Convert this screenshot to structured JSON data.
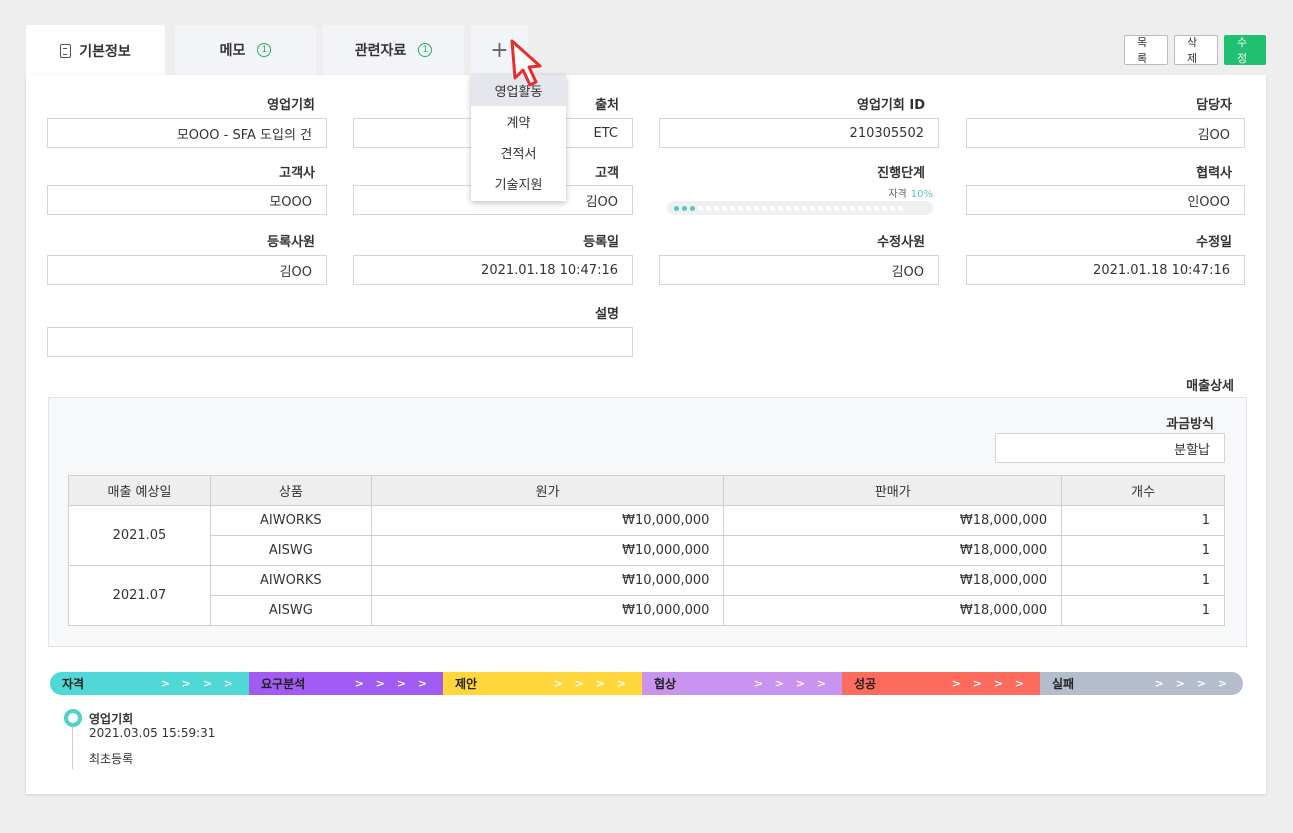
{
  "tabs": [
    {
      "label": "기본정보",
      "count": ""
    },
    {
      "label": "메모",
      "count": "1"
    },
    {
      "label": "관련자료",
      "count": "1"
    },
    {
      "label": "+",
      "count": ""
    }
  ],
  "buttons": {
    "list": "목록",
    "delete": "삭제",
    "edit": "수정"
  },
  "dropdown": [
    "영업활동",
    "계약",
    "견적서",
    "기술지원"
  ],
  "fields": {
    "opportunity": {
      "label": "영업기회",
      "value": "모OOO - SFA 도입의 건"
    },
    "source": {
      "label": "출처",
      "value": "ETC"
    },
    "opportunity_id": {
      "label": "영업기회 ID",
      "value": "210305502"
    },
    "owner": {
      "label": "담당자",
      "value": "김OO"
    },
    "company": {
      "label": "고객사",
      "value": "모OOO"
    },
    "customer": {
      "label": "고객",
      "value": "김OO"
    },
    "stage": {
      "label": "진행단계",
      "stage_name": "자격",
      "percent": "10%",
      "progress": 0.1
    },
    "partner": {
      "label": "협력사",
      "value": "인OOO"
    },
    "registrant": {
      "label": "등록사원",
      "value": "김OO"
    },
    "registered_date": {
      "label": "등록일",
      "value": "2021.01.18  10:47:16"
    },
    "modifier": {
      "label": "수정사원",
      "value": "김OO"
    },
    "modified_date": {
      "label": "수정일",
      "value": "2021.01.18  10:47:16"
    },
    "description": {
      "label": "설명",
      "value": ""
    }
  },
  "sales": {
    "title": "매출상세",
    "billing_label": "과금방식",
    "billing_value": "분할납",
    "headers": [
      "매출 예상일",
      "상품",
      "원가",
      "판매가",
      "개수"
    ],
    "groups": [
      {
        "date": "2021.05",
        "rows": [
          {
            "product": "AIWORKS",
            "cost": "₩10,000,000",
            "price": "₩18,000,000",
            "qty": "1"
          },
          {
            "product": "AISWG",
            "cost": "₩10,000,000",
            "price": "₩18,000,000",
            "qty": "1"
          }
        ]
      },
      {
        "date": "2021.07",
        "rows": [
          {
            "product": "AIWORKS",
            "cost": "₩10,000,000",
            "price": "₩18,000,000",
            "qty": "1"
          },
          {
            "product": "AISWG",
            "cost": "₩10,000,000",
            "price": "₩18,000,000",
            "qty": "1"
          }
        ]
      }
    ]
  },
  "stages": [
    {
      "label": "자격",
      "arrows": "> > > >",
      "color": "#4fd8d6"
    },
    {
      "label": "요구분석",
      "arrows": "> > > >",
      "color": "#a15bf0"
    },
    {
      "label": "제안",
      "arrows": "> > > >",
      "color": "#ffd73d"
    },
    {
      "label": "협상",
      "arrows": "> > > >",
      "color": "#c993f0"
    },
    {
      "label": "성공",
      "arrows": "> > > >",
      "color": "#fd6b5c"
    },
    {
      "label": "실패",
      "arrows": "> > > >",
      "color": "#b5bccb"
    }
  ],
  "timeline": {
    "title": "영업기회",
    "time": "2021.03.05  15:59:31",
    "desc": "최초등록"
  }
}
